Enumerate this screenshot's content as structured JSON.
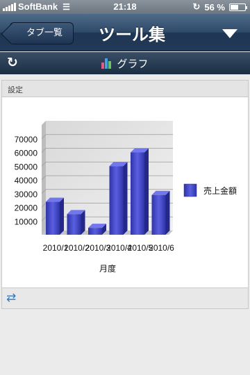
{
  "status_bar": {
    "carrier": "SoftBank",
    "time": "21:18",
    "battery_label": "56 %",
    "battery_level": 0.56
  },
  "nav": {
    "back_label": "タブ一覧",
    "title": "ツール集"
  },
  "toolbar": {
    "title": "グラフ"
  },
  "panel": {
    "header": "設定"
  },
  "chart_data": {
    "type": "bar",
    "categories": [
      "2010/1",
      "2010/2",
      "2010/3",
      "2010/4",
      "2010/5",
      "2010/6"
    ],
    "series": [
      {
        "name": "売上金額",
        "values": [
          24000,
          15000,
          5000,
          50000,
          60000,
          29000
        ],
        "color": "#3a3fc0"
      }
    ],
    "xlabel": "月度",
    "ylabel": "",
    "ylim": [
      0,
      80000
    ],
    "yticks": [
      10000,
      20000,
      30000,
      40000,
      50000,
      60000,
      70000
    ],
    "grid": true,
    "legend": "right"
  }
}
